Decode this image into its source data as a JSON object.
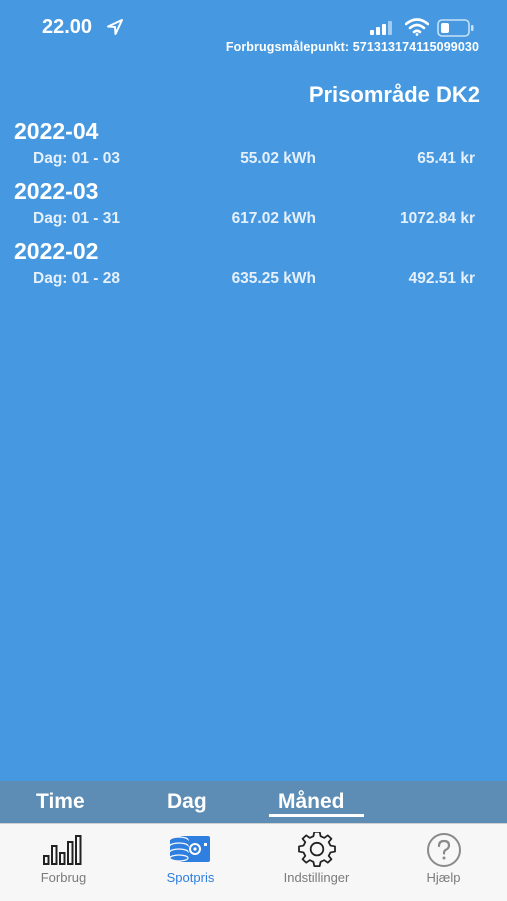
{
  "status": {
    "time": "22.00",
    "meter_label": "Forbrugsmålepunkt: 571313174115099030"
  },
  "price_area": "Prisområde DK2",
  "months": [
    {
      "title": "2022-04",
      "days": "Dag: 01 - 03",
      "kwh": "55.02 kWh",
      "cost": "65.41 kr"
    },
    {
      "title": "2022-03",
      "days": "Dag: 01 - 31",
      "kwh": "617.02 kWh",
      "cost": "1072.84 kr"
    },
    {
      "title": "2022-02",
      "days": "Dag: 01 - 28",
      "kwh": "635.25 kWh",
      "cost": "492.51 kr"
    }
  ],
  "period_tabs": {
    "time": "Time",
    "dag": "Dag",
    "maaned": "Måned",
    "selected": "Måned"
  },
  "tabbar": {
    "items": [
      {
        "label": "Forbrug",
        "icon": "bar-chart-icon"
      },
      {
        "label": "Spotpris",
        "icon": "spotpris-icon"
      },
      {
        "label": "Indstillinger",
        "icon": "gear-icon"
      },
      {
        "label": "Hjælp",
        "icon": "help-icon"
      }
    ],
    "active": "Spotpris"
  },
  "colors": {
    "background": "#4699e0",
    "period_bar": "#5d8db4",
    "tabbar": "#f7f7f7",
    "active_tab": "#2f7fe0",
    "inactive_tab": "#7b7b7b"
  }
}
